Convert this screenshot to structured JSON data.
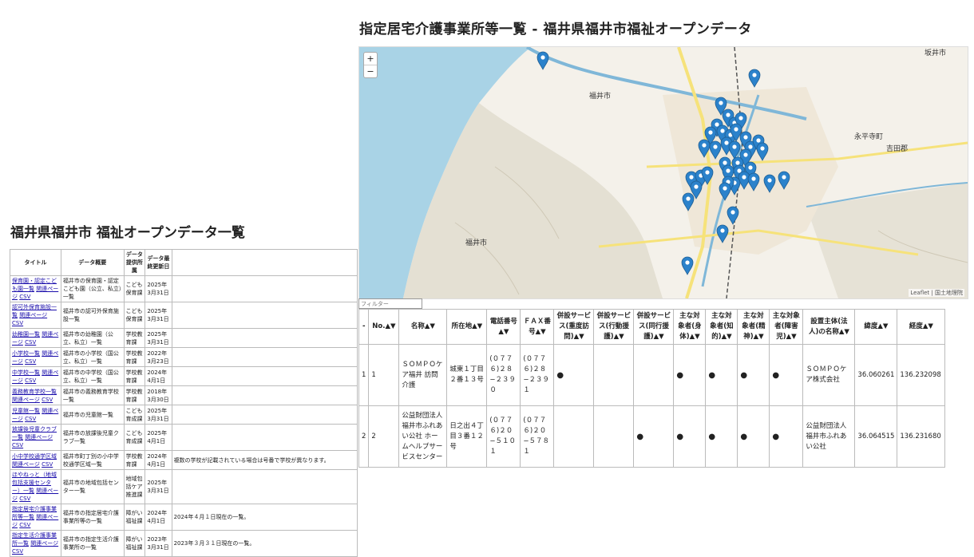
{
  "right_page": {
    "title": "指定居宅介護事業所等一覧 - 福井県福井市福祉オープンデータ",
    "map": {
      "zoom_in": "+",
      "zoom_out": "−",
      "attribution": "Leaflet | 国土地理院",
      "labels": {
        "fukui_city_north": "福井市",
        "fukui_city_south": "福井市",
        "sakai_city": "坂井市",
        "eiheiji": "永平寺町",
        "yoshida": "吉田郡"
      }
    },
    "filter_placeholder": "フィルター",
    "table": {
      "headers": [
        "-",
        "No.▲▼",
        "名称▲▼",
        "所在地▲▼",
        "電話番号▲▼",
        "ＦＡＸ番号▲▼",
        "併設サービス(重度訪問)▲▼",
        "併設サービス(行動援護)▲▼",
        "併設サービス(同行援護)▲▼",
        "主な対象者(身体)▲▼",
        "主な対象者(知的)▲▼",
        "主な対象者(精神)▲▼",
        "主な対象者(障害児)▲▼",
        "設置主体(法人)の名称▲▼",
        "緯度▲▼",
        "経度▲▼"
      ],
      "rows": [
        [
          "1",
          "1",
          "ＳＯＭＰＯケア福井 訪問介護",
          "城東１丁目２番１３号",
          "(０７７６)２８−２３９０",
          "(０７７６)２８−２３９１",
          "●",
          "",
          "",
          "●",
          "●",
          "●",
          "●",
          "ＳＯＭＰＯケア株式会社",
          "36.060261",
          "136.232098"
        ],
        [
          "2",
          "2",
          "公益財団法人 福井市ふれあい公社 ホームヘルプサービスセンター",
          "日之出４丁目３番１２号",
          "(０７７６)２０−５１０１",
          "(０７７６)２０−５７８１",
          "",
          "",
          "●",
          "●",
          "●",
          "●",
          "●",
          "公益財団法人 福井市ふれあい公社",
          "36.064515",
          "136.231680"
        ]
      ]
    }
  },
  "left_page": {
    "title": "福井県福井市 福祉オープンデータ一覧",
    "headers": [
      "タイトル",
      "データ概要",
      "データ提供所属",
      "データ最終更新日",
      ""
    ],
    "rows": [
      {
        "title": "保育園・認定こども園一覧",
        "related": "関連ページ",
        "csv": "CSV",
        "summary": "福井市の保育園・認定こども園（公立、私立）一覧",
        "dept": "こども保育課",
        "date": "2025年3月31日",
        "note": ""
      },
      {
        "title": "認可外保育施設一覧",
        "related": "関連ページ",
        "csv": "CSV",
        "summary": "福井市の認可外保育施設一覧",
        "dept": "こども保育課",
        "date": "2025年3月31日",
        "note": ""
      },
      {
        "title": "幼稚園一覧",
        "related": "関連ページ",
        "csv": "CSV",
        "summary": "福井市の幼稚園（公立、私立）一覧",
        "dept": "学校教育課",
        "date": "2025年3月31日",
        "note": ""
      },
      {
        "title": "小学校一覧",
        "related": "関連ページ",
        "csv": "CSV",
        "summary": "福井市の小学校（国公立、私立）一覧",
        "dept": "学校教育課",
        "date": "2022年3月23日",
        "note": ""
      },
      {
        "title": "中学校一覧",
        "related": "関連ページ",
        "csv": "CSV",
        "summary": "福井市の中学校（国公立、私立）一覧",
        "dept": "学校教育課",
        "date": "2024年4月1日",
        "note": ""
      },
      {
        "title": "義務教育学校一覧",
        "related": "関連ページ",
        "csv": "CSV",
        "summary": "福井市の義務教育学校一覧",
        "dept": "学校教育課",
        "date": "2018年3月30日",
        "note": ""
      },
      {
        "title": "児童館一覧",
        "related": "関連ページ",
        "csv": "CSV",
        "summary": "福井市の児童館一覧",
        "dept": "こども育成課",
        "date": "2025年3月31日",
        "note": ""
      },
      {
        "title": "放課後児童クラブ一覧",
        "related": "関連ページ",
        "csv": "CSV",
        "summary": "福井市の放課後児童クラブ一覧",
        "dept": "こども育成課",
        "date": "2025年4月1日",
        "note": ""
      },
      {
        "title": "小中学校通学区域",
        "related": "関連ページ",
        "csv": "CSV",
        "summary": "福井市町丁別の小中学校通学区域一覧",
        "dept": "学校教育課",
        "date": "2024年4月1日",
        "note": "複数の学校が記載されている場合は号番で学校が異なります。"
      },
      {
        "title": "ほやねっと（地域包括支援センター）一覧",
        "related": "関連ページ",
        "csv": "CSV",
        "summary": "福井市の地域包括センター一覧",
        "dept": "地域包括ケア推進課",
        "date": "2025年3月31日",
        "note": ""
      },
      {
        "title": "指定居宅介護事業所等一覧",
        "related": "関連ページ",
        "csv": "CSV",
        "summary": "福井市の指定居宅介護事業所等の一覧",
        "dept": "障がい福祉課",
        "date": "2024年4月1日",
        "note": "2024年４月１日現在の一覧。"
      },
      {
        "title": "指定生活介護事業所一覧",
        "related": "関連ページ",
        "csv": "CSV",
        "summary": "福井市の指定生活介護事業所の一覧",
        "dept": "障がい福祉課",
        "date": "2023年3月31日",
        "note": "2023年３月３１日現在の一覧。"
      }
    ]
  },
  "colors": {
    "marker": "#2b82cb",
    "link": "#1a0dab",
    "water": "#a9d3e6",
    "river": "#7fb7d8",
    "road": "#f6e27a"
  }
}
